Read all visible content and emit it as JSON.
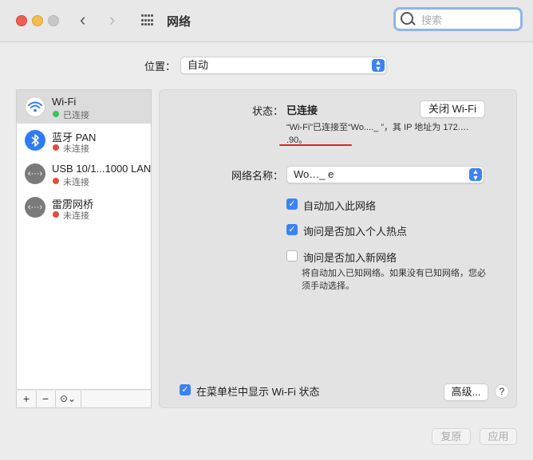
{
  "window": {
    "title": "网络"
  },
  "search": {
    "placeholder": "搜索"
  },
  "location": {
    "label": "位置：",
    "value": "自动"
  },
  "services": [
    {
      "name": "Wi-Fi",
      "status": "已连接",
      "status_color": "#34c759",
      "icon": "wifi-icon",
      "icon_bg": "#ffffff",
      "selected": true
    },
    {
      "name": "蓝牙 PAN",
      "status": "未连接",
      "status_color": "#e64a3f",
      "icon": "bluetooth-icon",
      "icon_bg": "#2f7cf6"
    },
    {
      "name": "USB 10/1...1000 LAN",
      "status": "未连接",
      "status_color": "#e64a3f",
      "icon": "ethernet-icon",
      "icon_bg": "#7a7a7a"
    },
    {
      "name": "雷雳网桥",
      "status": "未连接",
      "status_color": "#e64a3f",
      "icon": "ethernet-icon",
      "icon_bg": "#7a7a7a"
    }
  ],
  "sidebar_buttons": {
    "add": "+",
    "remove": "−",
    "more": "⊙⌄"
  },
  "detail": {
    "status_label": "状态：",
    "status_value": "已连接",
    "wifi_off_button": "关闭 Wi-Fi",
    "description": "“Wi-Fi”已连接至“Wo...._    ”，其 IP 地址为 172.…  .90。",
    "network_name_label": "网络名称：",
    "network_name_value": "Wo…_    e",
    "checkboxes": [
      {
        "label": "自动加入此网络",
        "checked": true
      },
      {
        "label": "询问是否加入个人热点",
        "checked": true
      },
      {
        "label": "询问是否加入新网络",
        "checked": false
      }
    ],
    "hint": "将自动加入已知网络。如果没有已知网络，您必须手动选择。",
    "menubar_checkbox": {
      "label": "在菜单栏中显示 Wi-Fi 状态",
      "checked": true
    },
    "advanced_button": "高级...",
    "help_button": "?"
  },
  "footer": {
    "revert_button": "复原",
    "apply_button": "应用"
  },
  "colors": {
    "accent": "#3b82f6",
    "annotation_underline": "#e02020"
  }
}
